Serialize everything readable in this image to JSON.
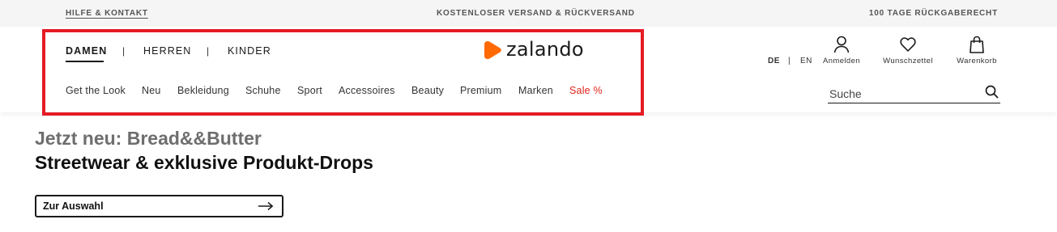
{
  "topbar": {
    "help": "HILFE & KONTAKT",
    "shipping": "KOSTENLOSER VERSAND & RÜCKVERSAND",
    "returns": "100 TAGE RÜCKGABERECHT"
  },
  "nav": {
    "genders": [
      "DAMEN",
      "HERREN",
      "KINDER"
    ],
    "separator": "|",
    "active_gender": "DAMEN",
    "categories": [
      "Get the Look",
      "Neu",
      "Bekleidung",
      "Schuhe",
      "Sport",
      "Accessoires",
      "Beauty",
      "Premium",
      "Marken",
      "Sale %"
    ]
  },
  "logo": {
    "text": "zalando",
    "color": "#ff6900"
  },
  "lang": {
    "de": "DE",
    "sep": "|",
    "en": "EN",
    "active": "DE"
  },
  "actions": {
    "login": "Anmelden",
    "wishlist": "Wunschzettel",
    "cart": "Warenkorb"
  },
  "search": {
    "placeholder": "Suche"
  },
  "hero": {
    "title": "Jetzt neu: Bread&&Butter",
    "subtitle": "Streetwear & exklusive Produkt-Drops",
    "cta": "Zur Auswahl"
  },
  "colors": {
    "sale": "#e2231a",
    "highlight": "#e51b24",
    "brand": "#ff6900"
  },
  "icons": {
    "login": "person-icon",
    "wishlist": "heart-icon",
    "cart": "shopping-bag-icon",
    "search": "search-icon",
    "cta": "arrow-right-icon"
  }
}
